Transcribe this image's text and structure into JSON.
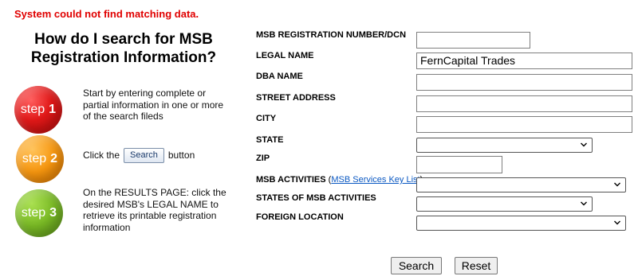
{
  "error_message": "System could not find matching data.",
  "help": {
    "heading": "How do I search for MSB Registration Information?",
    "steps": [
      {
        "word": "step",
        "number": "1",
        "color": "#e01818",
        "text": "Start by entering complete or partial information in one or more of the search fileds"
      },
      {
        "word": "step",
        "number": "2",
        "color": "#f6960f",
        "text_before": "Click the",
        "button_label": "Search",
        "text_after": "button"
      },
      {
        "word": "step",
        "number": "3",
        "color": "#78b824",
        "text": "On the RESULTS PAGE: click the desired MSB's LEGAL NAME to retrieve its printable registration information"
      }
    ]
  },
  "form": {
    "msb_reg_number": {
      "label": "MSB REGISTRATION NUMBER/DCN",
      "value": ""
    },
    "legal_name": {
      "label": "LEGAL NAME",
      "value": "FernCapital Trades"
    },
    "dba_name": {
      "label": "DBA NAME",
      "value": ""
    },
    "street_address": {
      "label": "STREET ADDRESS",
      "value": ""
    },
    "city": {
      "label": "CITY",
      "value": ""
    },
    "state": {
      "label": "STATE",
      "selected": ""
    },
    "zip": {
      "label": "ZIP",
      "value": ""
    },
    "msb_activities": {
      "label": "MSB ACTIVITIES",
      "link_text": "MSB Services Key List",
      "selected": ""
    },
    "states_of_msb_activities": {
      "label": "STATES OF MSB ACTIVITIES",
      "selected": ""
    },
    "foreign_location": {
      "label": "FOREIGN LOCATION",
      "selected": ""
    },
    "search_button": "Search",
    "reset_button": "Reset"
  },
  "colors": {
    "error": "#e00000",
    "link": "#0a58c2"
  },
  "icons": {
    "dropdown": "chevron-down-icon"
  }
}
